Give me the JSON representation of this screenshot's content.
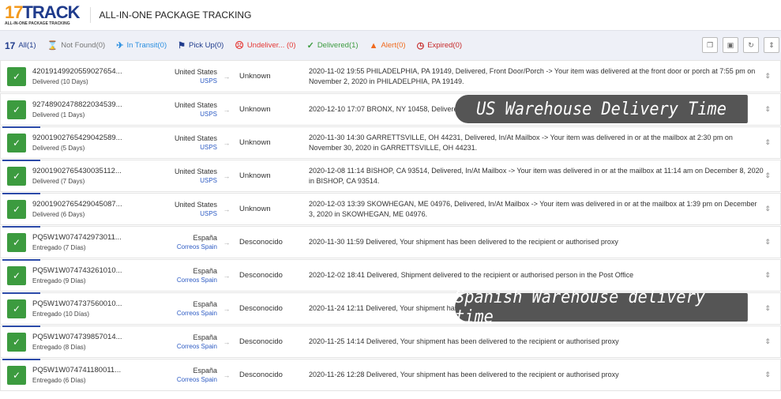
{
  "header": {
    "logo_text": "17TRACK",
    "logo_sub": "ALL-IN-ONE PACKAGE TRACKING",
    "title": "ALL-IN-ONE PACKAGE TRACKING"
  },
  "filters": [
    {
      "label": "All(1)",
      "color": "#1f3b8c",
      "icon": "17-logo-icon"
    },
    {
      "label": "Not Found(0)",
      "color": "#777777",
      "icon": "hourglass-icon"
    },
    {
      "label": "In Transit(0)",
      "color": "#2b8fe0",
      "icon": "plane-icon"
    },
    {
      "label": "Pick Up(0)",
      "color": "#1f3b8c",
      "icon": "flag-icon"
    },
    {
      "label": "Undeliver... (0)",
      "color": "#e53935",
      "icon": "sad-face-icon"
    },
    {
      "label": "Delivered(1)",
      "color": "#3c9b3f",
      "icon": "check-icon"
    },
    {
      "label": "Alert(0)",
      "color": "#f06a1e",
      "icon": "warning-icon"
    },
    {
      "label": "Expired(0)",
      "color": "#c62828",
      "icon": "clock-history-icon"
    }
  ],
  "tools": [
    "copy-icon",
    "clipboard-icon",
    "refresh-icon",
    "collapse-icon"
  ],
  "rows": [
    {
      "number": "42019149920559027654...",
      "status": "Delivered (10 Days)",
      "origin": "United States",
      "carrier": "USPS",
      "destination": "Unknown",
      "event": "2020-11-02 19:55  PHILADELPHIA, PA 19149, Delivered, Front Door/Porch -> Your item was delivered at the front door or porch at 7:55 pm on November 2, 2020 in PHILADELPHIA, PA 19149."
    },
    {
      "number": "92748902478822034539...",
      "status": "Delivered (1 Days)",
      "origin": "United States",
      "carrier": "USPS",
      "destination": "Unknown",
      "event": "2020-12-10 17:07  BRONX, NY 10458, Delivered, Le... 10, 2020 in BRONX, NY 10458."
    },
    {
      "number": "92001902765429042589...",
      "status": "Delivered (5 Days)",
      "origin": "United States",
      "carrier": "USPS",
      "destination": "Unknown",
      "event": "2020-11-30 14:30  GARRETTSVILLE, OH 44231, Delivered, In/At Mailbox -> Your item was delivered in or at the mailbox at 2:30 pm on November 30, 2020 in GARRETTSVILLE, OH 44231."
    },
    {
      "number": "92001902765430035112...",
      "status": "Delivered (7 Days)",
      "origin": "United States",
      "carrier": "USPS",
      "destination": "Unknown",
      "event": "2020-12-08 11:14  BISHOP, CA 93514, Delivered, In/At Mailbox -> Your item was delivered in or at the mailbox at 11:14 am on December 8, 2020 in BISHOP, CA 93514."
    },
    {
      "number": "92001902765429045087...",
      "status": "Delivered (6 Days)",
      "origin": "United States",
      "carrier": "USPS",
      "destination": "Unknown",
      "event": "2020-12-03 13:39  SKOWHEGAN, ME 04976, Delivered, In/At Mailbox -> Your item was delivered in or at the mailbox at 1:39 pm on December 3, 2020 in SKOWHEGAN, ME 04976."
    },
    {
      "number": "PQ5W1W074742973011...",
      "status": "Entregado (7 Días)",
      "origin": "España",
      "carrier": "Correos Spain",
      "destination": "Desconocido",
      "event": "2020-11-30 11:59  Delivered, Your shipment has been delivered to the recipient or authorised proxy"
    },
    {
      "number": "PQ5W1W074743261010...",
      "status": "Entregado (9 Días)",
      "origin": "España",
      "carrier": "Correos Spain",
      "destination": "Desconocido",
      "event": "2020-12-02 18:41  Delivered, Shipment delivered to the recipient or authorised person in the Post Office"
    },
    {
      "number": "PQ5W1W074737560010...",
      "status": "Entregado (10 Días)",
      "origin": "España",
      "carrier": "Correos Spain",
      "destination": "Desconocido",
      "event": "2020-11-24 12:11  Delivered, Your shipment has be..."
    },
    {
      "number": "PQ5W1W074739857014...",
      "status": "Entregado (8 Días)",
      "origin": "España",
      "carrier": "Correos Spain",
      "destination": "Desconocido",
      "event": "2020-11-25 14:14  Delivered, Your shipment has been delivered to the recipient or authorised proxy"
    },
    {
      "number": "PQ5W1W074741180011...",
      "status": "Entregado (6 Días)",
      "origin": "España",
      "carrier": "Correos Spain",
      "destination": "Desconocido",
      "event": "2020-11-26 12:28  Delivered, Your shipment has been delivered to the recipient or authorised proxy"
    }
  ],
  "overlays": {
    "us": "US Warehouse Delivery Time",
    "es": "Spanish Warehouse delivery time"
  }
}
